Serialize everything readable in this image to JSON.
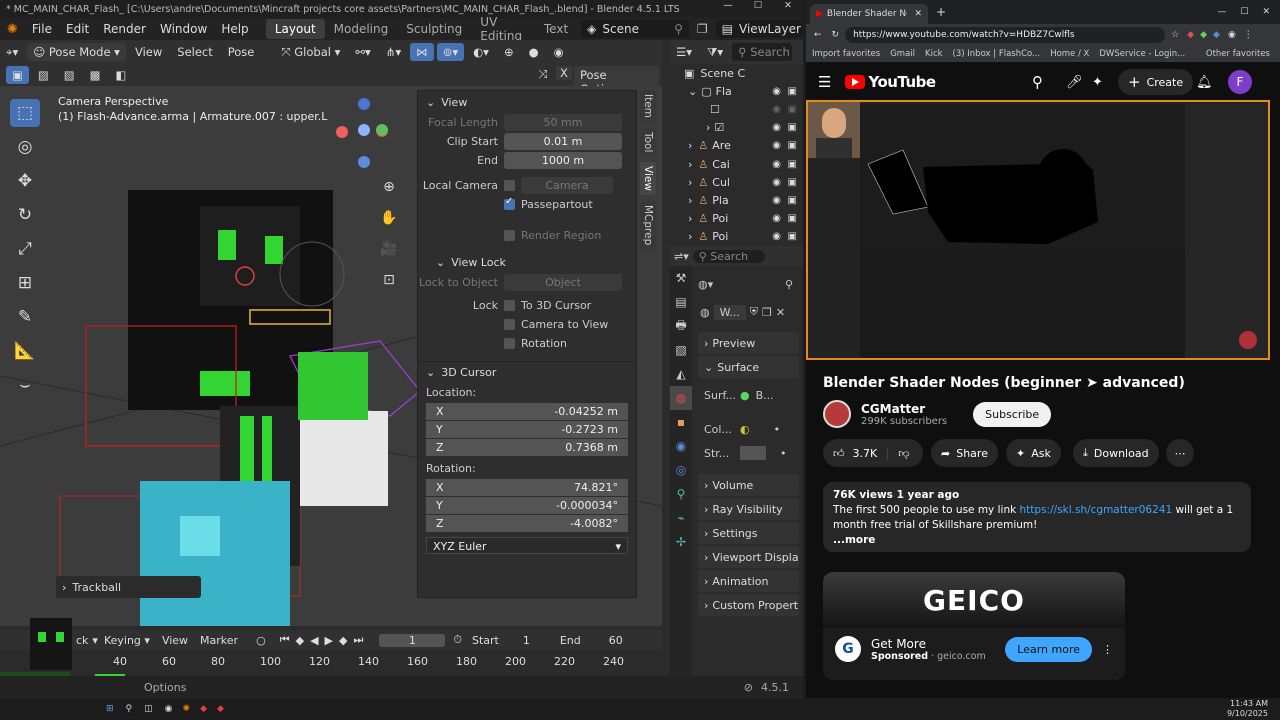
{
  "blender": {
    "title": "* MC_MAIN_CHAR_Flash_ [C:\\Users\\andre\\Documents\\Mincraft projects core assets\\Partners\\MC_MAIN_CHAR_Flash_.blend] - Blender 4.5.1 LTS",
    "menu": [
      "File",
      "Edit",
      "Render",
      "Window",
      "Help"
    ],
    "workspaces": [
      "Layout",
      "Modeling",
      "Sculpting",
      "UV Editing",
      "Text"
    ],
    "scene": "Scene",
    "view_layer": "ViewLayer",
    "header": {
      "mode": "Pose Mode",
      "items": [
        "View",
        "Select",
        "Pose"
      ],
      "orientation": "Global",
      "search_placeholder": "Search",
      "pose_options": "Pose Options"
    },
    "viewport": {
      "line1": "Camera Perspective",
      "line2": "(1) Flash-Advance.arma | Armature.007 : upper.L"
    },
    "npanel": {
      "view_header": "View",
      "focal_length_label": "Focal Length",
      "focal_length": "50 mm",
      "clip_start_label": "Clip Start",
      "clip_start": "0.01 m",
      "end_label": "End",
      "clip_end": "1000 m",
      "local_camera_label": "Local Camera",
      "camera_placeholder": "Camera",
      "passepartout": "Passepartout",
      "render_region": "Render Region",
      "view_lock_header": "View Lock",
      "lock_to_object_label": "Lock to Object",
      "object_placeholder": "Object",
      "lock_label": "Lock",
      "to_3d_cursor": "To 3D Cursor",
      "camera_to_view": "Camera to View",
      "rotation_lock": "Rotation",
      "cursor_header": "3D Cursor",
      "location_label": "Location:",
      "loc": [
        {
          "axis": "X",
          "value": "-0.04252 m"
        },
        {
          "axis": "Y",
          "value": "-0.2723 m"
        },
        {
          "axis": "Z",
          "value": "0.7368 m"
        }
      ],
      "rotation_label": "Rotation:",
      "rot": [
        {
          "axis": "X",
          "value": "74.821°"
        },
        {
          "axis": "Y",
          "value": "-0.000034°"
        },
        {
          "axis": "Z",
          "value": "-4.0082°"
        }
      ],
      "rotation_mode": "XYZ Euler",
      "tabs": [
        "Item",
        "Tool",
        "View",
        "MCprep"
      ]
    },
    "trackball": "Trackball",
    "timeline": {
      "keying": "Keying",
      "view": "View",
      "marker": "Marker",
      "current_frame": "1",
      "start_label": "Start",
      "start": "1",
      "end_label": "End",
      "end": "60",
      "ruler": [
        "40",
        "60",
        "80",
        "100",
        "120",
        "140",
        "160",
        "180",
        "200",
        "220",
        "240"
      ],
      "playback_partial": "ck"
    },
    "outliner": {
      "root": "Scene C",
      "items": [
        "Fla",
        "",
        "",
        "Are",
        "Cai",
        "Cul",
        "Pla",
        "Poi",
        "Poi"
      ]
    },
    "properties": {
      "search_placeholder": "Search",
      "world_name": "W...",
      "sections": [
        "Preview",
        "Surface",
        "Volume",
        "Ray Visibility",
        "Settings",
        "Viewport Display",
        "Animation",
        "Custom Propertie"
      ],
      "surf_label": "Surf...",
      "surf_value": "B...",
      "color_label": "Col...",
      "strength_label": "Str..."
    },
    "status": {
      "options": "Options",
      "version": "4.5.1"
    }
  },
  "browser": {
    "tab_title": "Blender Shader Nodes (beg",
    "url": "https://www.youtube.com/watch?v=HDBZ7Cwlfls",
    "bookmarks": [
      "Import favorites",
      "Gmail",
      "Kick",
      "(3) Inbox | FlashCo...",
      "Home / X",
      "DWService - Login..."
    ],
    "other_bookmarks": "Other favorites",
    "yt": {
      "logo": "YouTube",
      "create": "Create",
      "avatar": "F",
      "video_title": "Blender Shader Nodes (beginner ➤ advanced)",
      "channel": "CGMatter",
      "subscribers": "299K subscribers",
      "subscribe": "Subscribe",
      "likes": "3.7K",
      "share": "Share",
      "ask": "Ask",
      "download": "Download",
      "views": "76K views  1 year ago",
      "desc_before": "The first 500 people to use my link ",
      "desc_link": "https://skl.sh/cgmatter06241",
      "desc_after": " will get a 1 month free trial of Skillshare premium!",
      "more": "...more",
      "ad_brand": "GEICO",
      "ad_title": "Get More",
      "ad_sponsored": "Sponsored",
      "ad_domain": "geico.com",
      "ad_cta": "Learn more"
    }
  },
  "taskbar": {
    "time": "11:43 AM",
    "date": "9/10/2025"
  },
  "colors": {
    "accent_blue": "#4772b3",
    "yt_red": "#ff0000",
    "highlight_orange": "#e58a1c",
    "learn_more_blue": "#3ea6ff"
  }
}
